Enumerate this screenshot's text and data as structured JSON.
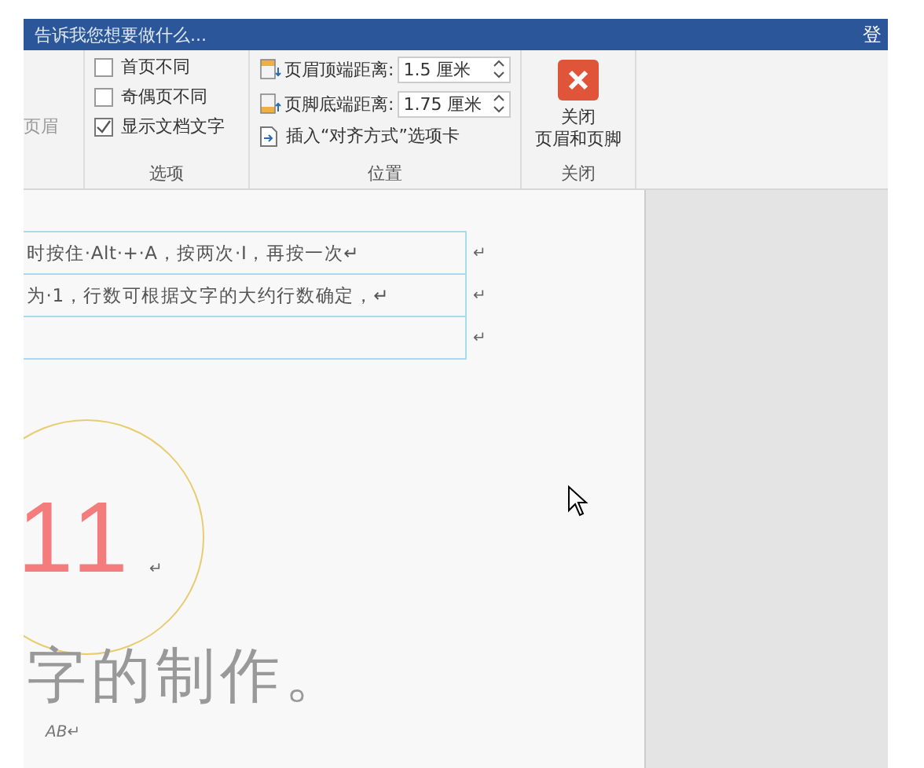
{
  "search": {
    "placeholder": "告诉我您想要做什么..."
  },
  "account": "登",
  "ribbon": {
    "cut_label": "页眉",
    "options": {
      "checkboxes": [
        {
          "label": "首页不同",
          "checked": false
        },
        {
          "label": "奇偶页不同",
          "checked": false
        },
        {
          "label": "显示文档文字",
          "checked": true
        }
      ],
      "title": "选项"
    },
    "position": {
      "fields": [
        {
          "kind": "header",
          "label": "页眉顶端距离:",
          "value": "1.5 厘米"
        },
        {
          "kind": "footer",
          "label": "页脚底端距离:",
          "value": "1.75 厘米"
        }
      ],
      "insert_tab": "插入“对齐方式”选项卡",
      "title": "位置"
    },
    "close": {
      "lines": [
        "关闭",
        "页眉和页脚"
      ],
      "title": "关闭"
    }
  },
  "document": {
    "rows": [
      {
        "text": "时按住·Alt·+·A，按两次·I，再按一次↵",
        "mark": "↵"
      },
      {
        "text": "为·1，行数可根据文字的大约行数确定，↵",
        "mark": "↵"
      },
      {
        "text": "",
        "mark": "↵"
      }
    ],
    "badge_number": "11",
    "badge_mark": "↵",
    "title_text": "字的制作。",
    "small_text": "AB↵"
  }
}
